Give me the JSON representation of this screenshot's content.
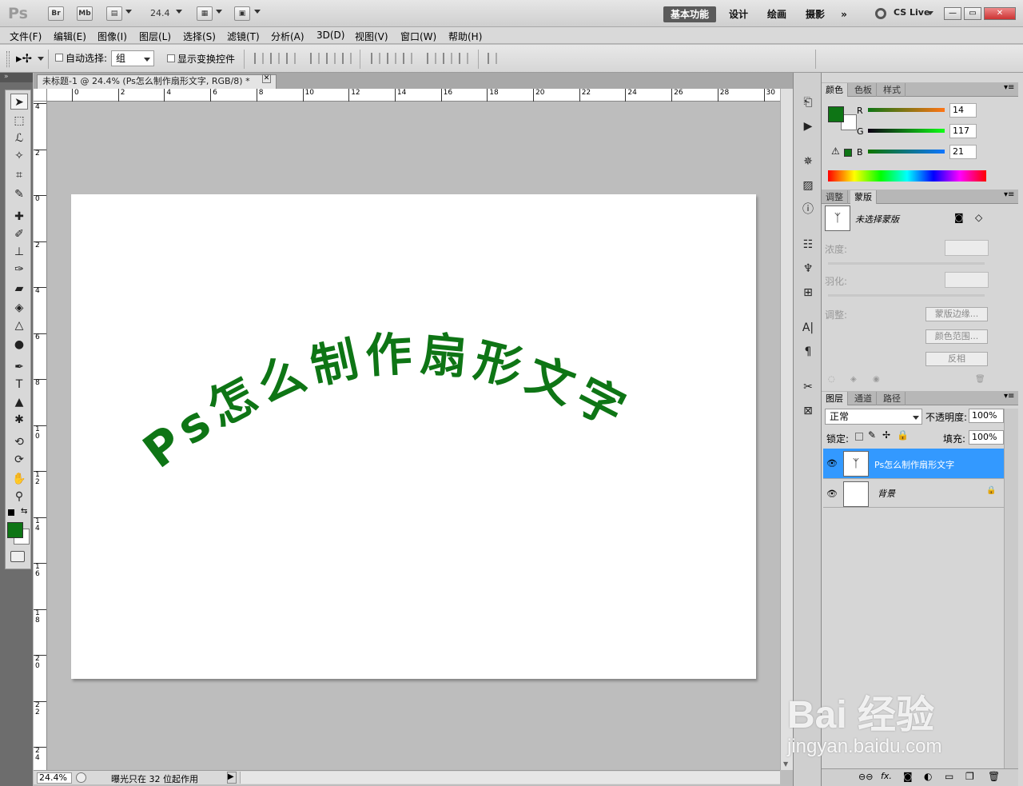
{
  "app": {
    "logo": "Ps",
    "bridge": "Br",
    "minibridge": "Mb",
    "zoom": "24.4",
    "workspaces": [
      "基本功能",
      "设计",
      "绘画",
      "摄影"
    ],
    "more": "»",
    "cslive": "CS Live",
    "window_min": "—",
    "window_restore": "▭",
    "window_close": "✕"
  },
  "menu": [
    "文件(F)",
    "编辑(E)",
    "图像(I)",
    "图层(L)",
    "选择(S)",
    "滤镜(T)",
    "分析(A)",
    "3D(D)",
    "视图(V)",
    "窗口(W)",
    "帮助(H)"
  ],
  "options": {
    "auto_select_label": "自动选择:",
    "auto_select_value": "组",
    "show_transform_label": "显示变换控件"
  },
  "document": {
    "tab_title": "未标题-1 @ 24.4% (Ps怎么制作扇形文字, RGB/8) *",
    "arc_text": "Ps怎么制作扇形文字",
    "text_color": "#0e7515",
    "h_ticks": [
      "0",
      "2",
      "4",
      "6",
      "8",
      "10",
      "12",
      "14",
      "16",
      "18",
      "20",
      "22",
      "24",
      "26",
      "28",
      "30"
    ],
    "v_ticks": [
      "4",
      "2",
      "0",
      "2",
      "4",
      "6",
      "8",
      "1 0",
      "1 2",
      "1 4",
      "1 6",
      "1 8",
      "2 0",
      "2 2",
      "2 4"
    ],
    "left_tick": "4"
  },
  "status": {
    "zoom": "24.4%",
    "info": "曝光只在 32 位起作用"
  },
  "color_panel": {
    "tabs": [
      "颜色",
      "色板",
      "样式"
    ],
    "r_label": "R",
    "g_label": "G",
    "b_label": "B",
    "r": "14",
    "g": "117",
    "b": "21",
    "foreground": "#0e7515"
  },
  "masks_panel": {
    "tabs": [
      "调整",
      "蒙版"
    ],
    "no_mask": "未选择蒙版",
    "density": "浓度:",
    "feather": "羽化:",
    "refine": "调整:",
    "mask_edge": "蒙版边缘...",
    "color_range": "颜色范围...",
    "invert": "反相"
  },
  "layers_panel": {
    "tabs": [
      "图层",
      "通道",
      "路径"
    ],
    "blend": "正常",
    "opacity_label": "不透明度:",
    "opacity": "100%",
    "lock_label": "锁定:",
    "fill_label": "填充:",
    "fill": "100%",
    "layers": [
      {
        "name": "Ps怎么制作扇形文字",
        "selected": true
      },
      {
        "name": "背景",
        "selected": false
      }
    ]
  },
  "watermark": {
    "brand": "Bai  经验",
    "url": "jingyan.baidu.com"
  }
}
